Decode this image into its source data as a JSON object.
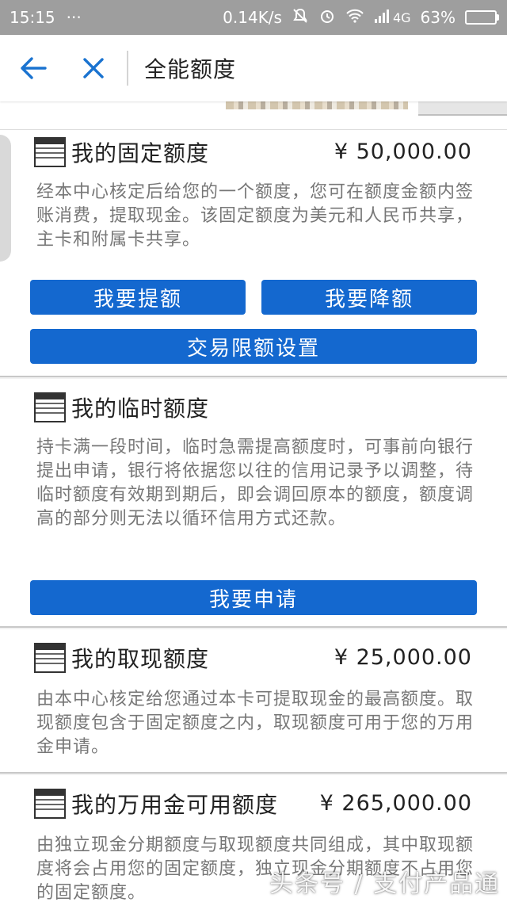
{
  "status_bar": {
    "time": "15:15",
    "dots": "···",
    "net_speed": "0.14K/s",
    "signal": "4G",
    "battery": "63%",
    "battery_level": 0.63,
    "battery_color": "#43d243"
  },
  "nav": {
    "back_icon": "arrow-left-icon",
    "close_icon": "close-icon",
    "title": "全能额度",
    "icon_color": "#1a73d0"
  },
  "cards": {
    "fixed": {
      "title": "我的固定额度",
      "amount": "¥ 50,000.00",
      "desc": "经本中心核定后给您的一个额度，您可在额度金额内签账消费，提取现金。该固定额度为美元和人民币共享，主卡和附属卡共享。",
      "btn_increase": "我要提额",
      "btn_decrease": "我要降额",
      "btn_limit": "交易限额设置"
    },
    "temporary": {
      "title": "我的临时额度",
      "desc": "持卡满一段时间，临时急需提高额度时，可事前向银行提出申请，银行将依据您以往的信用记录予以调整，待临时额度有效期到期后，即会调回原本的额度，额度调高的部分则无法以循环信用方式还款。",
      "btn_apply": "我要申请"
    },
    "cash": {
      "title": "我的取现额度",
      "amount": "¥ 25,000.00",
      "desc": "由本中心核定给您通过本卡可提取现金的最高额度。取现额度包含于固定额度之内，取现额度可用于您的万用金申请。"
    },
    "wanyongjin": {
      "title": "我的万用金可用额度",
      "amount": "¥ 265,000.00",
      "desc": "由独立现金分期额度与取现额度共同组成，其中取现额度将会占用您的固定额度，独立现金分期额度不占用您的固定额度。"
    }
  },
  "accent_color": "#1468cf",
  "watermark": "头条号 / 支付产品通"
}
